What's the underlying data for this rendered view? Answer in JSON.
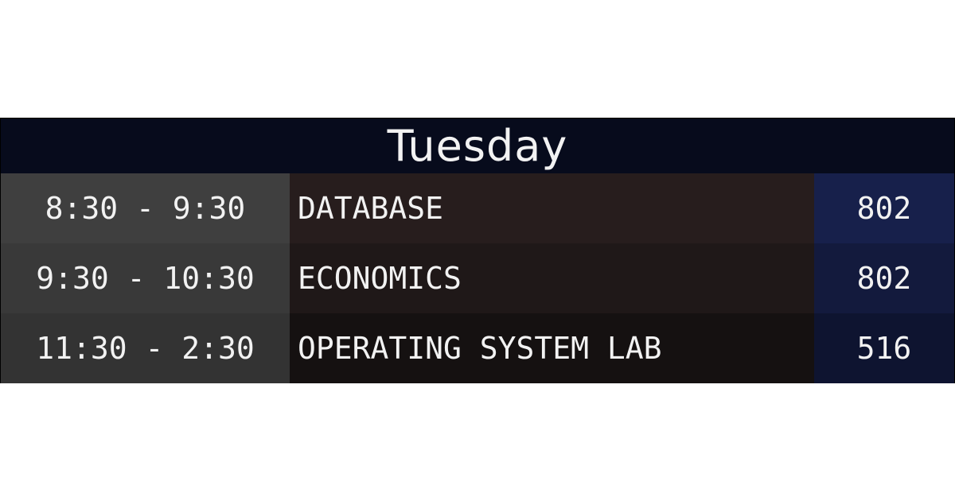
{
  "schedule": {
    "day": "Tuesday",
    "rows": [
      {
        "time": "8:30 - 9:30",
        "subject": "DATABASE",
        "room": "802"
      },
      {
        "time": "9:30 - 10:30",
        "subject": "ECONOMICS",
        "room": "802"
      },
      {
        "time": "11:30 - 2:30",
        "subject": "OPERATING SYSTEM LAB",
        "room": "516"
      }
    ]
  }
}
